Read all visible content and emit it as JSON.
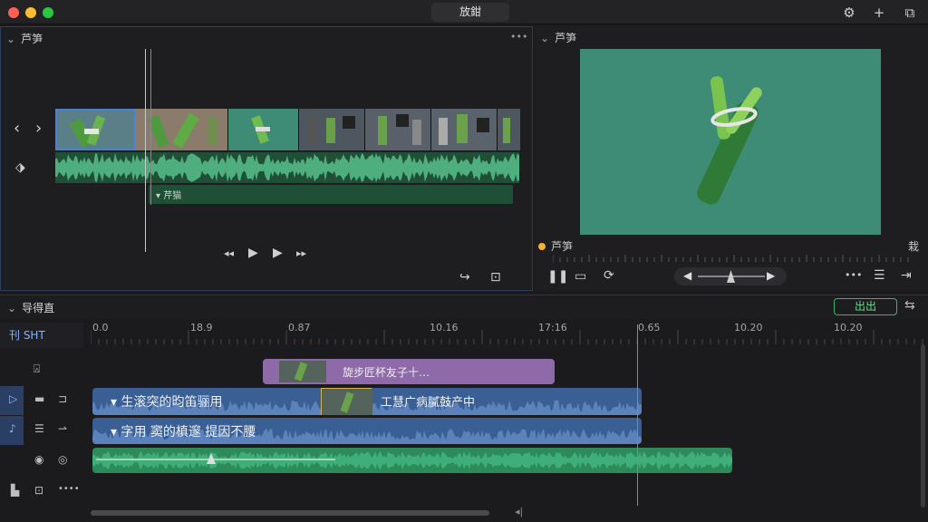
{
  "window": {
    "title": "放鉗",
    "traffic_colors": [
      "#ff5f57",
      "#febc2e",
      "#28c840"
    ]
  },
  "toolbar": {
    "settings_icon": "gear-icon",
    "add_icon": "plus-icon",
    "share_icon": "share-icon"
  },
  "browser": {
    "header": "芦笋",
    "menu_label": "•••",
    "clip_label": "芹猫",
    "transport": [
      "◂◂",
      "▶",
      "▶",
      "▸▸"
    ]
  },
  "viewer": {
    "header": "芦笋",
    "clip_name": "芦笋",
    "clip_right_label": "栽"
  },
  "timeline": {
    "title": "导得直",
    "export_label": "出出",
    "sidebar_label": "刊 SHT",
    "ruler": [
      "0.0",
      "18.9",
      "0.87",
      "10.16",
      "17:16",
      "0.65",
      "10.20",
      "10.20"
    ],
    "clips": {
      "purple_label": "旋步匠杯友子十…",
      "blue1_label": "生滚突的昀笛骊用",
      "blue1_mid_label": "工慧广病膩鼓产中",
      "blue2_label": "字用 窦的槙邃  提因不腰"
    }
  },
  "colors": {
    "accent_blue": "#3a5f95",
    "accent_green": "#2c8a5b",
    "accent_purple": "#8e6aa8",
    "export_green": "#39b56a",
    "viewer_bg": "#3e8c76"
  }
}
